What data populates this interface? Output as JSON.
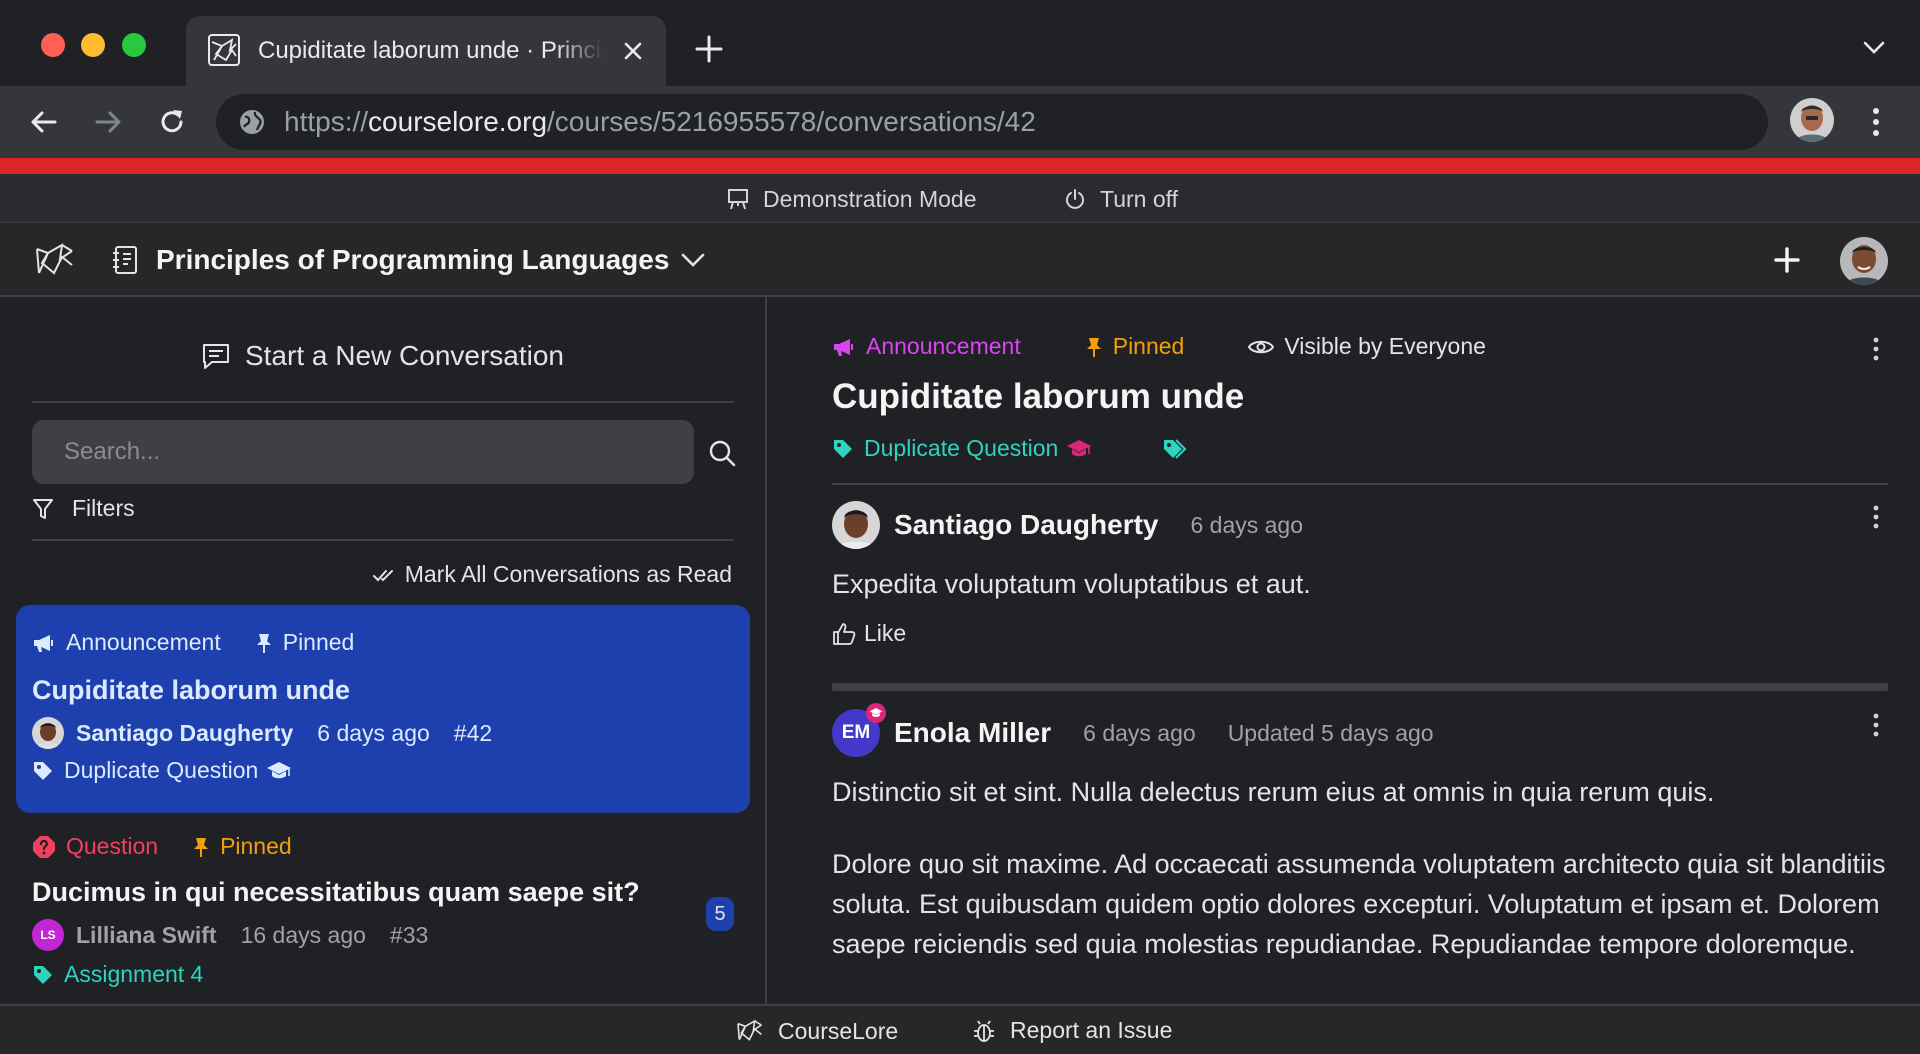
{
  "browser": {
    "tab_title": "Cupiditate laborum unde · Principles of Programming Languages · CourseLore",
    "url_scheme": "https://",
    "url_host": "courselore.org",
    "url_path": "/courses/5216955578/conversations/42"
  },
  "demo_bar": {
    "mode_label": "Demonstration Mode",
    "turn_off_label": "Turn off",
    "bar_color": "#dc2626"
  },
  "header": {
    "course_name": "Principles of Programming Languages"
  },
  "sidebar": {
    "start_new": "Start a New Conversation",
    "search_placeholder": "Search...",
    "filters_label": "Filters",
    "mark_read_label": "Mark All Conversations as Read",
    "conversations": [
      {
        "type": "Announcement",
        "pinned": "Pinned",
        "title": "Cupiditate laborum unde",
        "author": "Santiago Daugherty",
        "time": "6 days ago",
        "number": "#42",
        "tag": "Duplicate Question",
        "active": true
      },
      {
        "type": "Question",
        "pinned": "Pinned",
        "title": "Ducimus in qui necessitatibus quam saepe sit?",
        "author_initials": "LS",
        "author": "Lilliana Swift",
        "time": "16 days ago",
        "number": "#33",
        "tag": "Assignment 4",
        "unread_count": "5"
      }
    ]
  },
  "conversation": {
    "type": "Announcement",
    "pinned": "Pinned",
    "visibility": "Visible by Everyone",
    "title": "Cupiditate laborum unde",
    "tag": "Duplicate Question",
    "messages": [
      {
        "author": "Santiago Daugherty",
        "time": "6 days ago",
        "body": "Expedita voluptatum voluptatibus et aut.",
        "like_label": "Like"
      },
      {
        "author_initials": "EM",
        "author": "Enola Miller",
        "time": "6 days ago",
        "updated": "Updated 5 days ago",
        "paragraphs": [
          "Distinctio sit et sint. Nulla delectus rerum eius at omnis in quia rerum quis.",
          "Dolore quo sit maxime. Ad occaecati assumenda voluptatem architecto quia sit blanditiis soluta. Est quibusdam quidem optio dolores excepturi. Voluptatum et ipsam et. Dolorem saepe reiciendis sed quia molestias repudiandae. Repudiandae tempore doloremque."
        ]
      }
    ]
  },
  "footer": {
    "brand": "CourseLore",
    "report": "Report an Issue"
  },
  "colors": {
    "announcement": "#d946ef",
    "pinned": "#f59e0b",
    "question": "#f43f5e",
    "tag": "#2dd4bf",
    "staff": "#db2777",
    "active_card": "#1e40af"
  }
}
